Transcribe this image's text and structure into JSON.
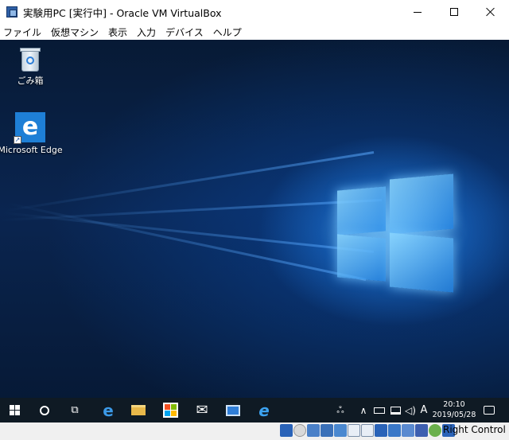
{
  "window": {
    "title": "実験用PC [実行中] - Oracle VM VirtualBox"
  },
  "menu": [
    "ファイル",
    "仮想マシン",
    "表示",
    "入力",
    "デバイス",
    "ヘルプ"
  ],
  "desktop": {
    "icons": [
      {
        "label": "ごみ箱",
        "icon": "recycle-bin-icon"
      },
      {
        "label": "Microsoft Edge",
        "icon": "edge-icon"
      }
    ]
  },
  "taskbar": {
    "apps": [
      "edge-icon",
      "file-explorer-icon",
      "store-icon",
      "mail-icon",
      "photos-icon",
      "internet-explorer-icon"
    ],
    "tray": {
      "ime": "A",
      "time": "20:10",
      "date": "2019/05/28"
    }
  },
  "statusbar": {
    "host_key": "Right Control"
  },
  "colors": {
    "accent": "#1e7fd6",
    "taskbar": "#0f1a24"
  }
}
